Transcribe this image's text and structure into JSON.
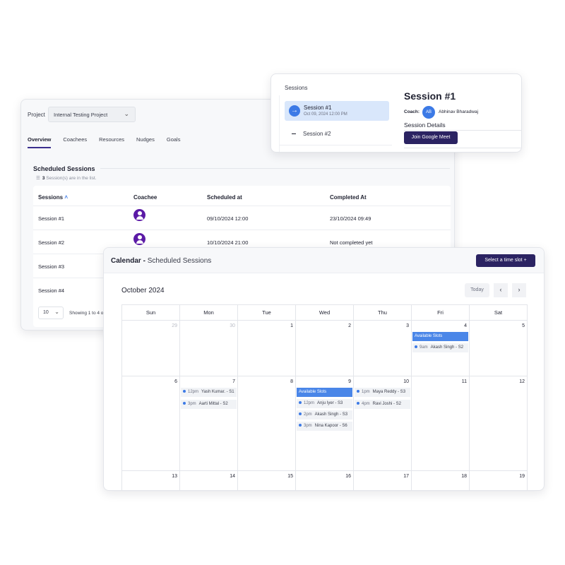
{
  "project_card": {
    "project_label": "Project",
    "project_value": "Internal Testing Project",
    "tabs": [
      "Overview",
      "Coachees",
      "Resources",
      "Nudges",
      "Goals"
    ],
    "active_tab": "Overview",
    "section_title": "Scheduled Sessions",
    "count": "3",
    "count_suffix": "Session(s) are in the list.",
    "columns": [
      "Sessions",
      "Coachee",
      "Scheduled at",
      "Completed At"
    ],
    "rows": [
      {
        "session": "Session #1",
        "scheduled": "09/10/2024 12:00",
        "completed": "23/10/2024 09:49"
      },
      {
        "session": "Session #2",
        "scheduled": "10/10/2024 21:00",
        "completed": "Not completed yet"
      },
      {
        "session": "Session #3",
        "scheduled": "",
        "completed": ""
      },
      {
        "session": "Session #4",
        "scheduled": "",
        "completed": ""
      }
    ],
    "page_size": "10",
    "showing": "Showing 1 to 4 o"
  },
  "session_card": {
    "header": "Sessions",
    "items": [
      {
        "title": "Session #1",
        "date": "Oct 09, 2024 12:00 PM"
      },
      {
        "title": "Session #2"
      }
    ],
    "detail_title": "Session #1",
    "coach_label": "Coach:",
    "coach_initials": "AB",
    "coach_name": "Abhinav Bharadwaj",
    "details_label": "Session Details",
    "join_label": "Join Google Meet"
  },
  "calendar": {
    "title_bold": "Calendar -",
    "title_rest": "Scheduled Sessions",
    "slot_button": "Select a time slot +",
    "month": "October 2024",
    "today": "Today",
    "prev": "‹",
    "next": "›",
    "weekdays": [
      "Sun",
      "Mon",
      "Tue",
      "Wed",
      "Thu",
      "Fri",
      "Sat"
    ],
    "week1": [
      "29",
      "30",
      "1",
      "2",
      "3",
      "4",
      "5"
    ],
    "week2": [
      "6",
      "7",
      "8",
      "9",
      "10",
      "11",
      "12"
    ],
    "week3": [
      "13",
      "14",
      "15",
      "16",
      "17",
      "18",
      "19"
    ],
    "available_label": "Available Slots",
    "fri4_events": [
      {
        "time": "9am",
        "name": "Akash Singh - S2"
      }
    ],
    "mon7_events": [
      {
        "time": "12pm",
        "name": "Yash Kumar. - S1"
      },
      {
        "time": "3pm",
        "name": "Aarti Mittal - S2"
      }
    ],
    "wed9_events": [
      {
        "time": "12pm",
        "name": "Anju Iyer - S3"
      },
      {
        "time": "2pm",
        "name": "Akash Singh - S3"
      },
      {
        "time": "3pm",
        "name": "Nina Kapoor - S6"
      }
    ],
    "thu10_events": [
      {
        "time": "1pm",
        "name": "Maya Reddy - S3"
      },
      {
        "time": "4pm",
        "name": "Ravi Joshi - S2"
      }
    ],
    "colors": {
      "accent": "#3c7ae6",
      "primary_button": "#2b2362",
      "available": "#4a86e8"
    }
  }
}
